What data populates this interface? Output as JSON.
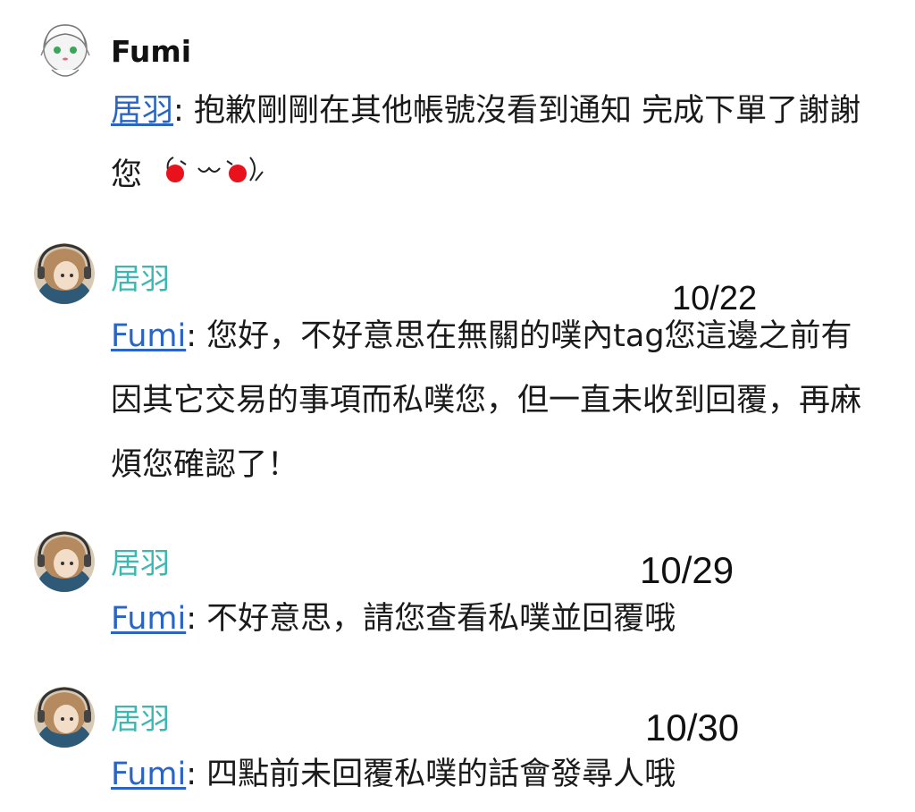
{
  "comments": [
    {
      "user": "Fumi",
      "mention": "居羽",
      "separator": ":",
      "text": " 抱歉剛剛在其他帳號沒看到通知 完成下單了謝謝您",
      "kaomoji": "(´ω`)"
    },
    {
      "user": "居羽",
      "date": "10/22",
      "mention": "Fumi",
      "separator": ":",
      "text": " 您好，不好意思在無關的噗內tag您這邊之前有因其它交易的事項而私噗您，但一直未收到回覆，再麻煩您確認了！"
    },
    {
      "user": "居羽",
      "date": "10/29",
      "mention": "Fumi",
      "separator": ":",
      "text": " 不好意思，請您查看私噗並回覆哦"
    },
    {
      "user": "居羽",
      "date": "10/30",
      "mention": "Fumi",
      "separator": ":",
      "text": " 四點前未回覆私噗的話會發尋人哦"
    }
  ],
  "colors": {
    "username_teal": "#3cb8b2",
    "mention_link": "#2a64c4",
    "kaomoji_cheek": "#e8111c"
  },
  "icons": {
    "avatar_fumi": "anime-girl-avatar-icon",
    "avatar_juyu": "headphone-character-avatar-icon"
  }
}
